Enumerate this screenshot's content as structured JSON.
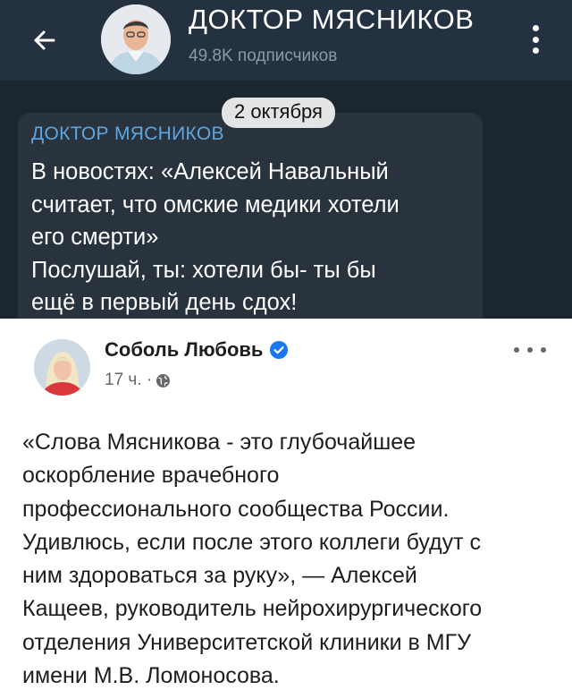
{
  "telegram": {
    "channel_title": "ДОКТОР МЯСНИКОВ",
    "subscribers": "49.8K подписчиков",
    "date_divider": "2 октября",
    "message": {
      "author": "ДОКТОР МЯСНИКОВ",
      "lines": [
        "В новостях: «Алексей Навальный",
        "считает, что омские медики хотели",
        "его смерти»",
        "Послушай, ты: хотели бы- ты бы",
        "ещё в первый день сдох!"
      ]
    },
    "icons": {
      "back": "back-arrow-icon",
      "menu": "more-vertical-icon"
    },
    "colors": {
      "header_bg": "#233140",
      "chat_bg": "#1c2631",
      "bubble_bg": "#29333e",
      "author": "#5fa6e0"
    }
  },
  "facebook": {
    "author_name": "Соболь Любовь",
    "time": "17 ч. ·",
    "post_lines": [
      "«Слова Мясникова - это глубочайшее",
      "оскорбление врачебного",
      "профессионального сообщества России.",
      "Удивлюсь, если после этого коллеги будут с",
      "ним здороваться за руку», — Алексей",
      "Кащеев, руководитель нейрохирургического",
      "отделения Университетской клиники в МГУ",
      "имени М.В. Ломоносова."
    ],
    "icons": {
      "verified": "verified-badge-icon",
      "audience": "globe-icon",
      "more": "more-horizontal-icon"
    },
    "colors": {
      "verified": "#1877f2",
      "text": "#1c1e21",
      "meta": "#65676b"
    }
  }
}
